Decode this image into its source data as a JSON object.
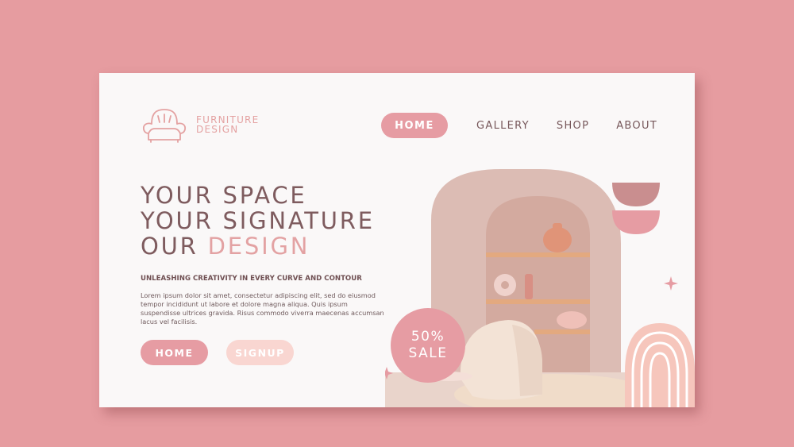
{
  "logo": {
    "line1": "FURNITURE",
    "line2": "DESIGN"
  },
  "nav": {
    "home": "HOME",
    "gallery": "GALLERY",
    "shop": "SHOP",
    "about": "ABOUT"
  },
  "hero": {
    "line1": "YOUR SPACE",
    "line2": "YOUR SIGNATURE",
    "line3_plain": "OUR ",
    "line3_accent": "DESIGN",
    "tagline": "UNLEASHING CREATIVITY IN EVERY CURVE AND CONTOUR",
    "body": "Lorem ipsum dolor sit amet, consectetur adipiscing elit, sed do eiusmod tempor incididunt ut labore et dolore magna aliqua. Quis ipsum suspendisse ultrices gravida. Risus commodo viverra maecenas accumsan lacus vel facilisis."
  },
  "buttons": {
    "home": "HOME",
    "signup": "SIGNUP"
  },
  "sale": {
    "line1": "50%",
    "line2": "SALE"
  },
  "colors": {
    "background": "#e69ca0",
    "card": "#faf8f8",
    "accent": "#e69ca3",
    "heading": "#7e5b5e",
    "light_accent": "#f9d6d1"
  }
}
